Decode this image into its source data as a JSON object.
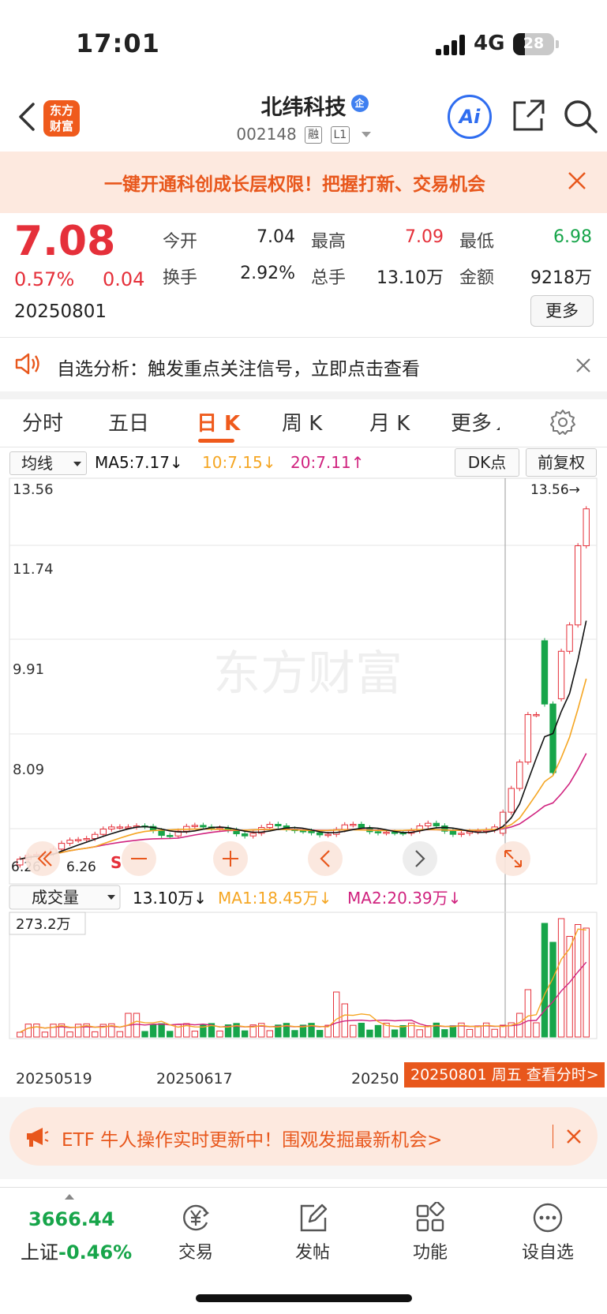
{
  "status": {
    "time": "17:01",
    "network": "4G",
    "battery": "28",
    "battery_level": 0.28
  },
  "header": {
    "stock_name": "北纬科技",
    "badge": "企",
    "stock_code": "002148",
    "tag_margin": "融",
    "tag_level": "L1",
    "brand_line1": "东方",
    "brand_line2": "财富",
    "ai_label": "Ai"
  },
  "promo": {
    "text": "一键开通科创成长层权限！把握打新、交易机会"
  },
  "quote": {
    "price": "7.08",
    "change_pct": "0.57%",
    "change": "0.04",
    "date": "20250801",
    "open_label": "今开",
    "open": "7.04",
    "high_label": "最高",
    "high": "7.09",
    "low_label": "最低",
    "low": "6.98",
    "turnover_label": "换手",
    "turnover": "2.92%",
    "volume_label": "总手",
    "volume": "13.10万",
    "amount_label": "金额",
    "amount": "9218万",
    "more_label": "更多",
    "colors": {
      "up": "#e5303a",
      "down": "#17a54a"
    }
  },
  "analysis": {
    "text": "自选分析：触发重点关注信号，立即点击查看"
  },
  "tabs": [
    {
      "label": "分时"
    },
    {
      "label": "五日"
    },
    {
      "label": "日 K"
    },
    {
      "label": "周 K"
    },
    {
      "label": "月 K"
    },
    {
      "label": "更多"
    }
  ],
  "chart_toolbar": {
    "indicator": "均线",
    "ma5": "MA5:7.17↓",
    "ma10": "10:7.15↓",
    "ma20": "20:7.11↑",
    "dk": "DK点",
    "adjust": "前复权"
  },
  "volume_toolbar": {
    "indicator": "成交量",
    "vol": "13.10万↓",
    "ma1": "MA1:18.45万↓",
    "ma2": "MA2:20.39万↓",
    "vol_max": "273.2万"
  },
  "chart_data": {
    "type": "candlestick",
    "y_ticks": [
      "13.56",
      "11.74",
      "9.91",
      "8.09"
    ],
    "ylim": [
      6.26,
      13.56
    ],
    "max_marker": "13.56→",
    "min_marker": "6.26",
    "min_left": "6.26",
    "sell_marker": "S",
    "watermark": "东方财富",
    "x_labels": [
      "20250519",
      "20250617",
      "20250"
    ],
    "series_colors": {
      "ma5": "#111111",
      "ma10": "#f5a623",
      "ma20": "#d0237f"
    }
  },
  "date_tip": "20250801 周五 查看分时>",
  "etf": {
    "text": "ETF 牛人操作实时更新中！围观发掘最新机会>"
  },
  "bottom": {
    "index_value": "3666.44",
    "index_name": "上证",
    "index_pct": "-0.46%",
    "nav": [
      {
        "label": "交易"
      },
      {
        "label": "发帖"
      },
      {
        "label": "功能"
      },
      {
        "label": "设自选"
      }
    ]
  }
}
